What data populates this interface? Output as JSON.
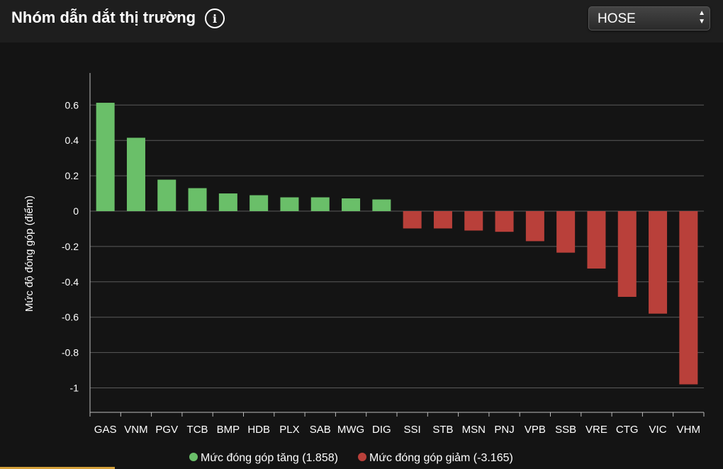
{
  "header": {
    "title": "Nhóm dẫn dắt thị trường",
    "info_icon": "info-icon",
    "exchange_select": {
      "value": "HOSE",
      "icon": "up-down-arrows-icon"
    }
  },
  "colors": {
    "positive": "#6abf69",
    "negative": "#b9403a",
    "background": "#141414",
    "header_background": "#1e1e1e",
    "grid": "#5a5a5a"
  },
  "chart_data": {
    "type": "bar",
    "title": "",
    "xlabel": "",
    "ylabel": "Mức độ đóng góp (điểm)",
    "ylim": [
      -1.2,
      0.78
    ],
    "yticks": [
      0.6,
      0.4,
      0.2,
      0,
      -0.2,
      -0.4,
      -0.6,
      -0.8,
      -1
    ],
    "ytick_labels": [
      "0.6",
      "0.4",
      "0.2",
      "0",
      "-0.2",
      "-0.4",
      "-0.6",
      "-0.8",
      "-1"
    ],
    "grid": true,
    "legend_position": "bottom-center",
    "categories": [
      "GAS",
      "VNM",
      "PGV",
      "TCB",
      "BMP",
      "HDB",
      "PLX",
      "SAB",
      "MWG",
      "DIG",
      "SSI",
      "STB",
      "MSN",
      "PNJ",
      "VPB",
      "SSB",
      "VRE",
      "CTG",
      "VIC",
      "VHM"
    ],
    "values": [
      0.613,
      0.415,
      0.178,
      0.13,
      0.1,
      0.09,
      0.078,
      0.078,
      0.072,
      0.066,
      -0.098,
      -0.098,
      -0.11,
      -0.117,
      -0.17,
      -0.235,
      -0.325,
      -0.485,
      -0.58,
      -0.98
    ],
    "series": [
      {
        "name": "Mức đóng góp tăng",
        "total": "(1.858)",
        "color": "#6abf69"
      },
      {
        "name": "Mức đóng góp giảm",
        "total": "(-3.165)",
        "color": "#b9403a"
      }
    ]
  }
}
